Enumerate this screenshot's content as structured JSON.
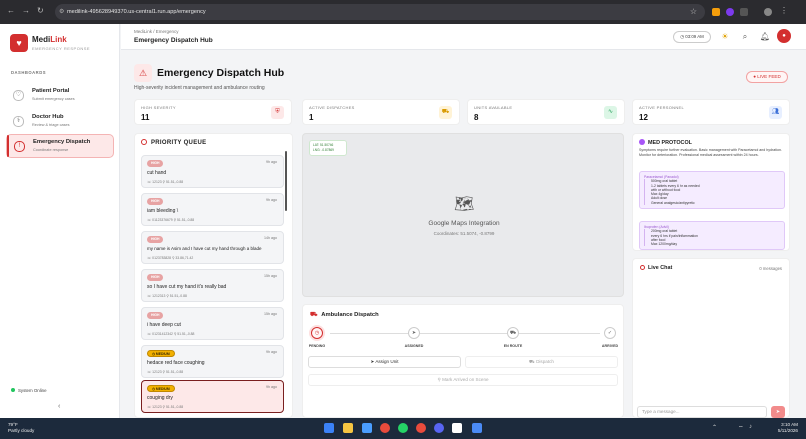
{
  "browser": {
    "url": "medilink-495628949370.us-central1.run.app/emergency"
  },
  "sidebar": {
    "logo_name_a": "Medi",
    "logo_name_b": "Link",
    "logo_sub": "EMERGENCY RESPONSE",
    "section": "DASHBOARDS",
    "items": [
      {
        "label": "Patient Portal",
        "sub": "Submit emergency cases"
      },
      {
        "label": "Doctor Hub",
        "sub": "Review & triage cases"
      },
      {
        "label": "Emergency Dispatch",
        "sub": "Coordinate response"
      }
    ],
    "status": "System Online",
    "collapse": "‹"
  },
  "header": {
    "breadcrumb": "MediLink / Emergency",
    "title": "Emergency Dispatch Hub",
    "clock": "03:09 AM"
  },
  "page": {
    "title": "Emergency Dispatch Hub",
    "subtitle": "High-severity incident management and ambulance routing",
    "live": "LIVE FEED"
  },
  "stats": [
    {
      "label": "HIGH SEVERITY",
      "value": "11",
      "color": "#fde8e8",
      "fg": "#d32f2f"
    },
    {
      "label": "ACTIVE DISPATCHES",
      "value": "1",
      "color": "#fff3d6",
      "fg": "#d99a00"
    },
    {
      "label": "UNITS AVAILABLE",
      "value": "8",
      "color": "#dcf6e6",
      "fg": "#1f9d55"
    },
    {
      "label": "ACTIVE PERSONNEL",
      "value": "12",
      "color": "#e7efff",
      "fg": "#3b6fd8"
    }
  ],
  "queue": {
    "title": "PRIORITY QUEUE",
    "cards": [
      {
        "badge": "HIGH",
        "ago": "9h ago",
        "text": "cut hand",
        "meta": "☏ 12123   ⚲ 51.51,-0.88"
      },
      {
        "badge": "HIGH",
        "ago": "9h ago",
        "text": "iam bleeding \\",
        "meta": "☏ 01123376679   ⚲ 51.51,-0.88"
      },
      {
        "badge": "HIGH",
        "ago": "14h ago",
        "text": "my name is Asim and I have cut my hand through a blade",
        "meta": "☏ 0123783828   ⚲ 33.86,71.42"
      },
      {
        "badge": "HIGH",
        "ago": "15h ago",
        "text": "so I have cut my hand it's really bad",
        "meta": "☏ 1212313   ⚲ 51.51,-0.88"
      },
      {
        "badge": "HIGH",
        "ago": "15h ago",
        "text": "i have deep cut",
        "meta": "☏ 01231412342   ⚲ 51.51,-0.88"
      },
      {
        "badge": "MEDIUM",
        "ago": "9h ago",
        "text": "hedace red face coughing",
        "meta": "☏ 12123   ⚲ 51.51,-0.88"
      },
      {
        "badge": "MEDIUM",
        "ago": "9h ago",
        "text": "couging dry",
        "meta": "☏ 12123   ⚲ 51.51,-0.88"
      }
    ]
  },
  "map": {
    "lat": "LAT: 51.50746",
    "lng": "LNG: -0.87869",
    "title": "Google Maps Integration",
    "coords": "Coordinates: 51.5074, -0.8799"
  },
  "dispatch": {
    "title": "Ambulance Dispatch",
    "steps": [
      "PENDING",
      "ASSIGNED",
      "EN ROUTE",
      "ARRIVED"
    ],
    "assign": "Assign Unit",
    "dispatch_btn": "Dispatch",
    "arrived": "Mark Arrived on Scene"
  },
  "protocol": {
    "title": "MED PROTOCOL",
    "desc": "Symptoms require further evaluation. Basic management with Paracetamol and hydration. Monitor for deterioration. Professional medical assessment within 24 hours.",
    "box1_title": "Paracetamol (Panadol)",
    "box1_lines": [
      "500mg oral tablet",
      "1-2 tablets every 6 hr as needed",
      "with or without food",
      "Max 4g/day",
      "Adult dose",
      "General analgesic/antipyretic"
    ],
    "box2_title": "Ibuprofen (Advil)",
    "box2_lines": [
      "200mg oral tablet",
      "every 6 hrs if pain/inflammation",
      "after food",
      "Max 1200mg/day"
    ]
  },
  "chat": {
    "title": "Live Chat",
    "count": "0 messages",
    "placeholder": "Type a message...",
    "send": "➤"
  },
  "taskbar": {
    "temp": "79°F",
    "weather": "Partly cloudy",
    "time": "3:10 AM",
    "date": "5/11/2026"
  }
}
